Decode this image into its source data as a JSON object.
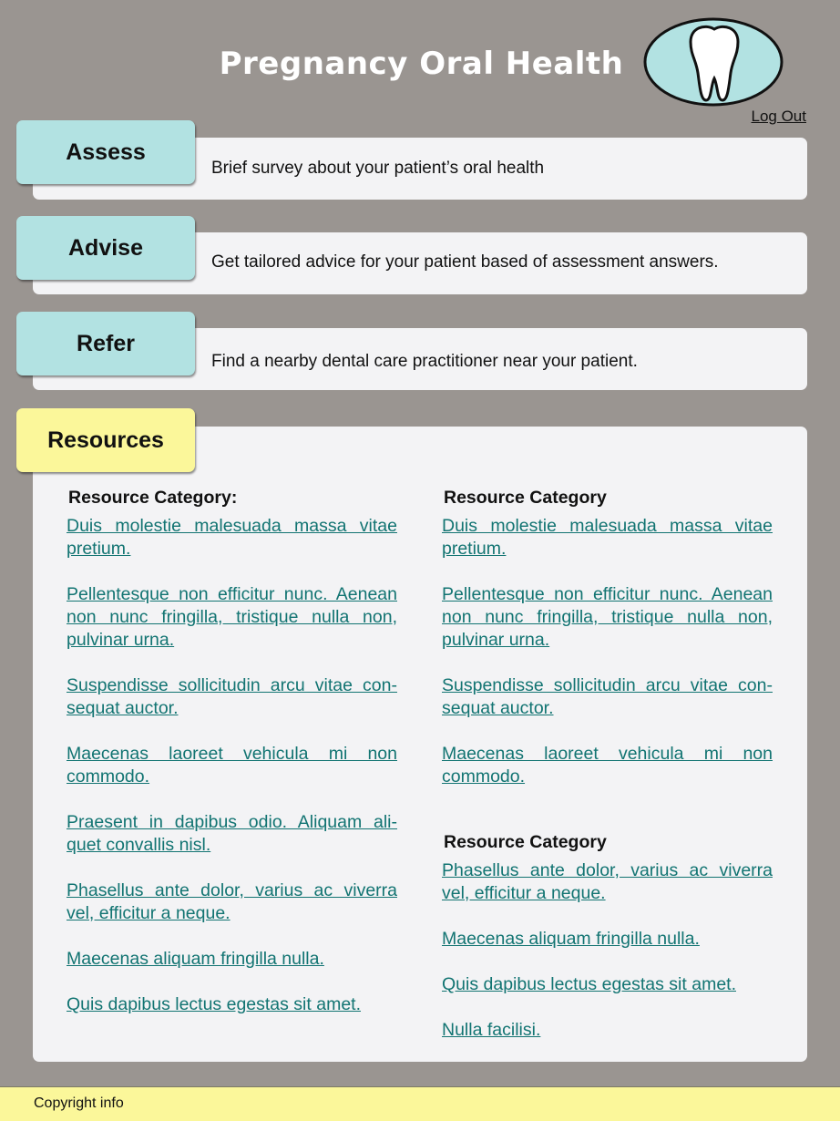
{
  "header": {
    "title": "Pregnancy Oral Health",
    "logout_label": "Log Out",
    "logo_icon": "tooth-icon"
  },
  "sections": {
    "assess": {
      "label": "Assess",
      "description": "Brief survey about your patient’s oral health"
    },
    "advise": {
      "label": "Advise",
      "description": "Get tailored advice for your patient based of assessment answers."
    },
    "refer": {
      "label": "Refer",
      "description": "Find a nearby dental care practitioner near your patient."
    }
  },
  "resources": {
    "label": "Resources",
    "col1": {
      "heading": "Resource Category:",
      "links": [
        "Duis molestie malesuada massa vitae pretium.",
        "Pellentesque non efficitur nunc. Aenean non nunc fringilla, tristique nulla non, pulvinar urna.",
        "Suspendisse sollicitudin arcu vitae con-sequat auctor.",
        "Maecenas laoreet vehicula mi non commodo.",
        "Praesent in dapibus odio. Aliquam ali-quet convallis nisl.",
        "Phasellus ante dolor, varius ac viverra vel, efficitur a neque.",
        "Maecenas aliquam fringilla nulla.",
        "Quis dapibus lectus egestas sit amet."
      ]
    },
    "col2": {
      "heading": "Resource Category",
      "links": [
        "Duis molestie malesuada massa vitae pretium.",
        "Pellentesque non efficitur nunc. Aenean non nunc fringilla, tristique nulla non, pulvinar urna.",
        "Suspendisse sollicitudin arcu vitae con-sequat auctor.",
        "Maecenas laoreet vehicula mi non commodo."
      ]
    },
    "col3": {
      "heading": "Resource Category",
      "links": [
        "Phasellus ante dolor, varius ac viverra vel, efficitur a neque.",
        "Maecenas aliquam fringilla nulla.",
        "Quis dapibus lectus egestas sit amet.",
        "Nulla facilisi."
      ]
    }
  },
  "footer": {
    "text": "Copyright info"
  },
  "colors": {
    "background": "#9a9591",
    "tab_teal": "#b2e2e2",
    "tab_yellow": "#fbf79a",
    "link": "#127472",
    "card": "#f3f3f5"
  }
}
